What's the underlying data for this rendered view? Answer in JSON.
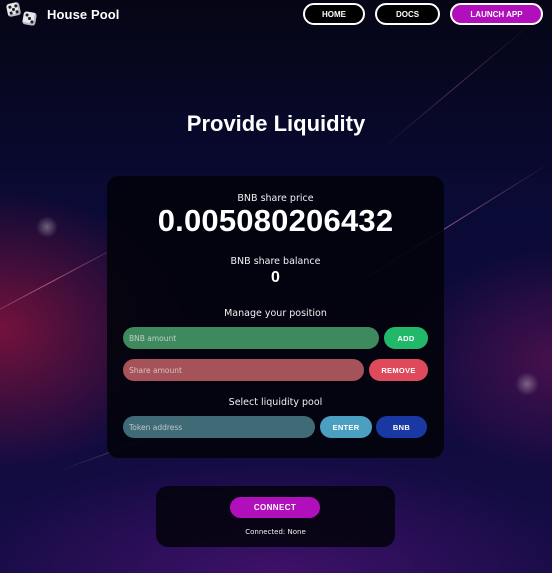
{
  "nav": {
    "brand": "House Pool",
    "home_label": "HOME",
    "docs_label": "DOCS",
    "launch_label": "LAUNCH APP",
    "logo_icon": "dice-icon"
  },
  "page": {
    "title": "Provide Liquidity"
  },
  "stats": {
    "share_price_label": "BNB share price",
    "share_price_value": "0.005080206432",
    "share_balance_label": "BNB share balance",
    "share_balance_value": "0"
  },
  "manage": {
    "heading": "Manage your position",
    "bnb_amount_placeholder": "BNB amount",
    "add_label": "ADD",
    "share_amount_placeholder": "Share amount",
    "remove_label": "REMOVE"
  },
  "pool": {
    "heading": "Select liquidity pool",
    "token_address_placeholder": "Token address",
    "enter_label": "ENTER",
    "bnb_label": "BNB"
  },
  "connect": {
    "button_label": "CONNECT",
    "status_text": "Connected: None"
  },
  "colors": {
    "accent": "#b10fbb",
    "add": "#21b86a",
    "remove": "#de4a5c",
    "enter": "#4b9fc1",
    "bnb": "#1a38a4"
  }
}
